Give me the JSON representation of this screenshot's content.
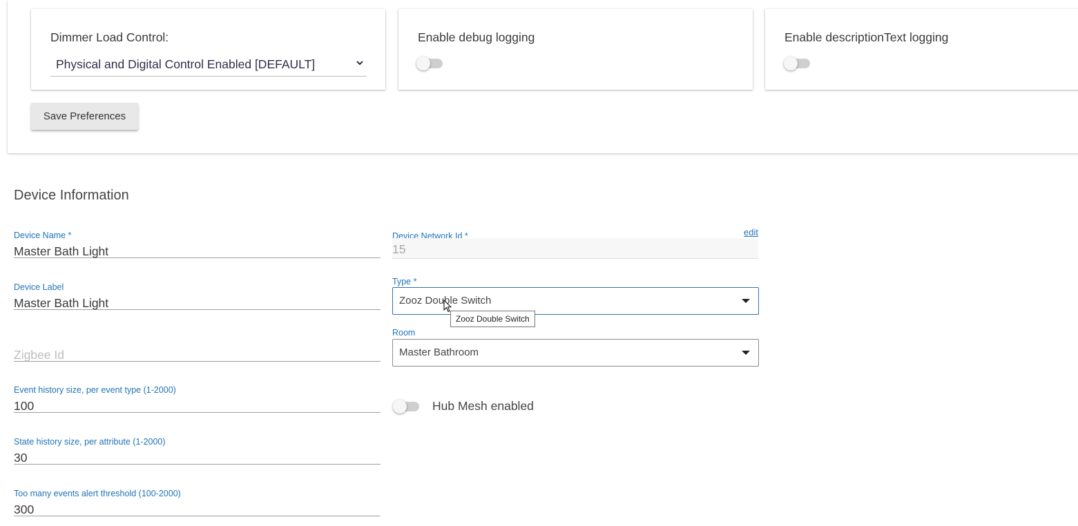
{
  "preferences": {
    "dimmer_load_control": {
      "label": "Dimmer Load Control:",
      "selected": "Physical and Digital Control Enabled [DEFAULT]"
    },
    "debug_logging": {
      "label": "Enable debug logging",
      "enabled": false
    },
    "description_text_logging": {
      "label": "Enable descriptionText logging",
      "enabled": false
    },
    "save_button": "Save Preferences"
  },
  "device_info": {
    "title": "Device Information",
    "device_name": {
      "label": "Device Name *",
      "value": "Master Bath Light"
    },
    "device_label": {
      "label": "Device Label",
      "value": "Master Bath Light"
    },
    "zigbee_id": {
      "placeholder": "Zigbee Id",
      "value": ""
    },
    "event_history": {
      "label": "Event history size, per event type (1-2000)",
      "value": "100"
    },
    "state_history": {
      "label": "State history size, per attribute (1-2000)",
      "value": "30"
    },
    "alert_threshold": {
      "label": "Too many events alert threshold (100-2000)",
      "value": "300"
    },
    "network_id": {
      "label": "Device Network Id *",
      "value": "15",
      "edit_link": "edit"
    },
    "type": {
      "label": "Type *",
      "selected": "Zooz Double Switch",
      "tooltip": "Zooz Double Switch"
    },
    "room": {
      "label": "Room",
      "selected": "Master Bathroom"
    },
    "hub_mesh": {
      "label": "Hub Mesh enabled",
      "enabled": false
    }
  },
  "colors": {
    "label_blue": "#1f73b7",
    "focus_border": "#2f6fb4",
    "toggle_track": "#cfcfcf"
  }
}
